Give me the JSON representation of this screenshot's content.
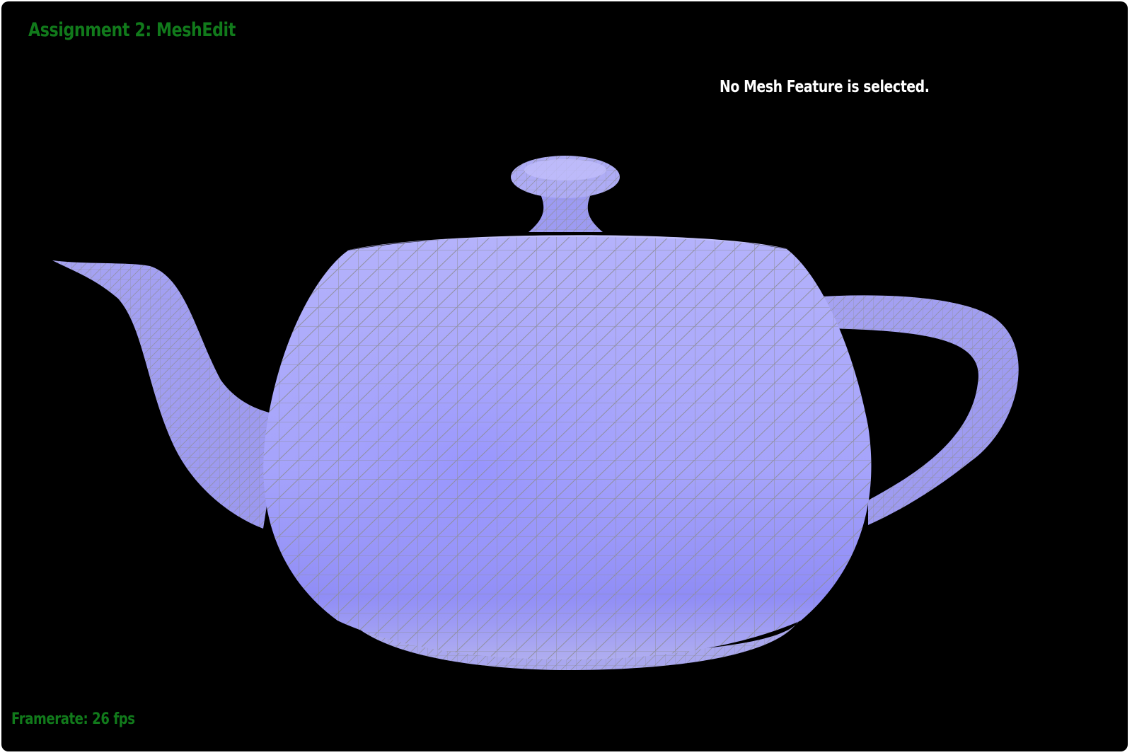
{
  "app": {
    "title": "Assignment 2: MeshEdit",
    "status": "No Mesh Feature is selected.",
    "framerate": "Framerate: 26 fps"
  },
  "colors": {
    "background": "#000000",
    "hud_text": "#117a1b",
    "status_text": "#ffffff",
    "mesh_fill": "#a7a5fb",
    "mesh_wire": "#8f8f9a"
  },
  "scene": {
    "object": "teapot-mesh",
    "render_mode": "shaded-wireframe"
  }
}
